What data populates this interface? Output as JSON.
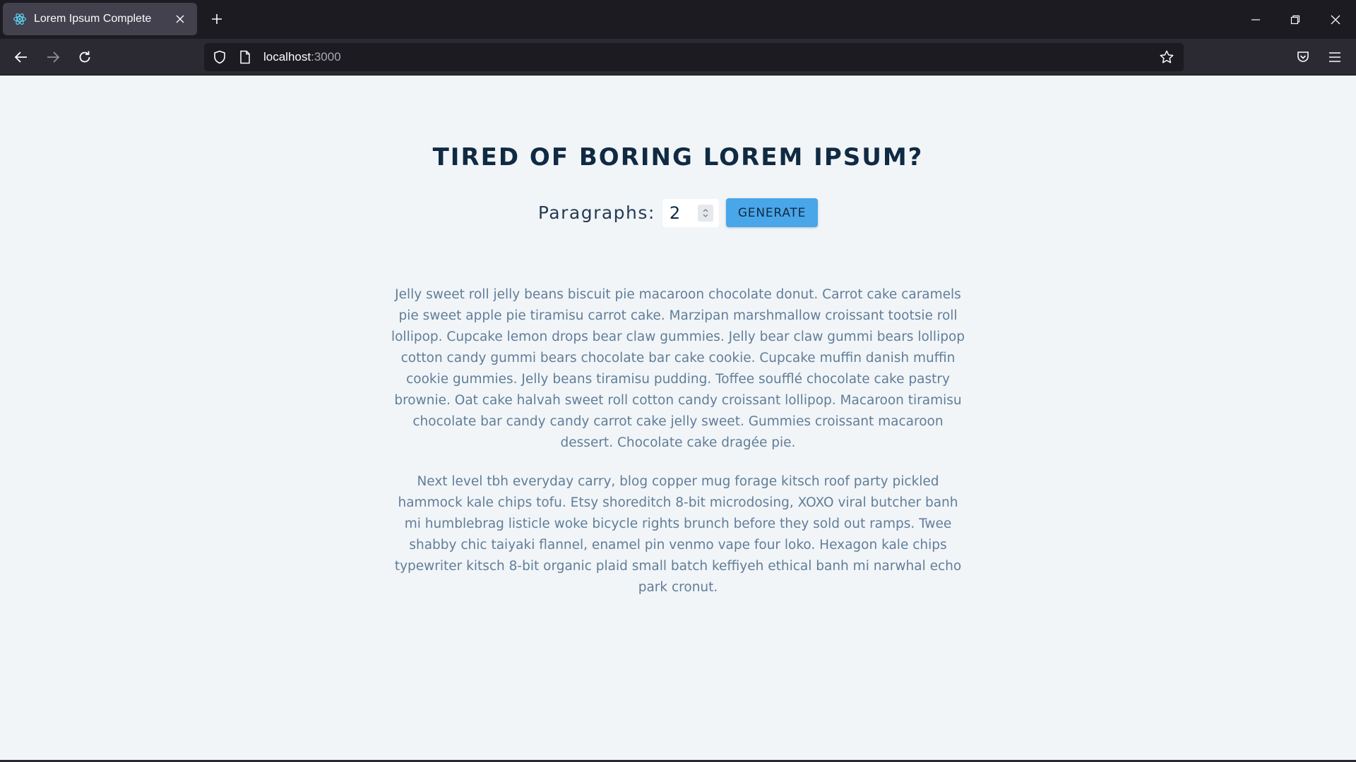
{
  "browser": {
    "tab_title": "Lorem Ipsum Complete",
    "url_host": "localhost",
    "url_port": ":3000"
  },
  "icons": {
    "favicon": "react-icon",
    "tab_close": "close-icon",
    "new_tab": "plus-icon",
    "minimize": "minimize-icon",
    "restore": "restore-icon",
    "close_window": "close-icon",
    "back": "arrow-left-icon",
    "forward": "arrow-right-icon",
    "reload": "reload-icon",
    "shield": "shield-icon",
    "page": "page-icon",
    "bookmark": "star-icon",
    "pocket": "pocket-icon",
    "menu": "hamburger-icon"
  },
  "colors": {
    "background": "#f1f5f8",
    "heading": "#102a43",
    "button": "#49a6e9",
    "paragraph": "#617d98"
  },
  "main": {
    "title": "Tired of boring lorem ipsum?",
    "form": {
      "label": "Paragraphs:",
      "count_value": "2",
      "button_label": "Generate"
    },
    "paragraphs": [
      "Jelly sweet roll jelly beans biscuit pie macaroon chocolate donut. Carrot cake caramels pie sweet apple pie tiramisu carrot cake. Marzipan marshmallow croissant tootsie roll lollipop. Cupcake lemon drops bear claw gummies. Jelly bear claw gummi bears lollipop cotton candy gummi bears chocolate bar cake cookie. Cupcake muffin danish muffin cookie gummies. Jelly beans tiramisu pudding. Toffee soufflé chocolate cake pastry brownie. Oat cake halvah sweet roll cotton candy croissant lollipop. Macaroon tiramisu chocolate bar candy candy carrot cake jelly sweet. Gummies croissant macaroon dessert. Chocolate cake dragée pie.",
      "Next level tbh everyday carry, blog copper mug forage kitsch roof party pickled hammock kale chips tofu. Etsy shoreditch 8-bit microdosing, XOXO viral butcher banh mi humblebrag listicle woke bicycle rights brunch before they sold out ramps. Twee shabby chic taiyaki flannel, enamel pin venmo vape four loko. Hexagon kale chips typewriter kitsch 8-bit organic plaid small batch keffiyeh ethical banh mi narwhal echo park cronut."
    ]
  }
}
